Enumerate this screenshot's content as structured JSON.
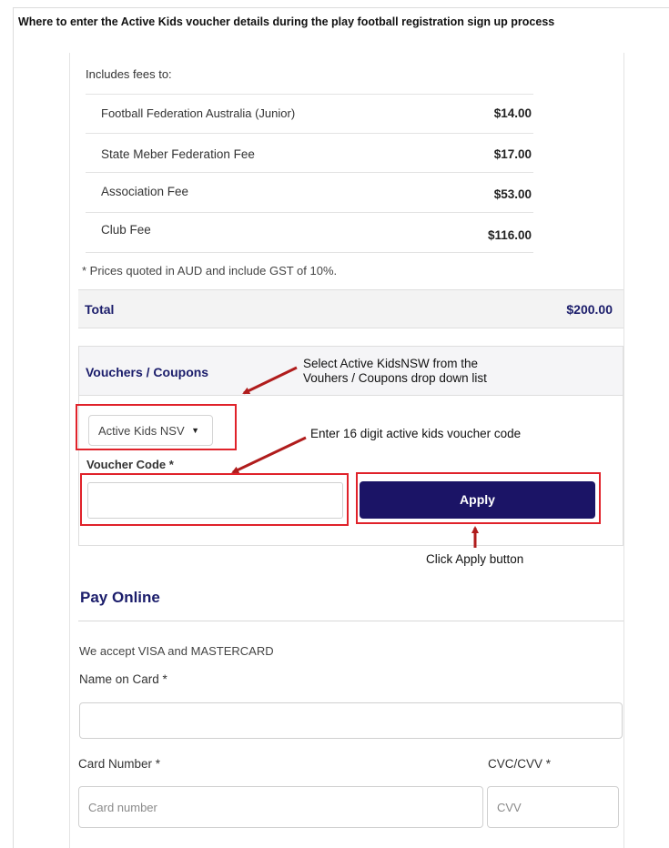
{
  "header": {
    "title": "Where to enter the Active Kids voucher details during the play football registration sign up process"
  },
  "fees": {
    "includes_label": "Includes fees to:",
    "items": [
      {
        "name": "Football Federation Australia (Junior)",
        "amount": "$14.00"
      },
      {
        "name": "State Meber Federation Fee",
        "amount": "$17.00"
      },
      {
        "name": "Association Fee",
        "amount": "$53.00"
      },
      {
        "name": "Club Fee",
        "amount": "$116.00"
      }
    ],
    "note": "* Prices quoted in AUD and include GST of 10%."
  },
  "total": {
    "label": "Total",
    "amount": "$200.00"
  },
  "vouchers": {
    "title": "Vouchers / Coupons",
    "select_value": "Active Kids NSV",
    "code_label": "Voucher Code *",
    "code_value": "",
    "apply_label": "Apply"
  },
  "annotations": {
    "select_line1": "Select Active KidsNSW from the",
    "select_line2": "Vouhers / Coupons drop down list",
    "enter_code": "Enter 16 digit active kids voucher code",
    "click_apply": "Click Apply button",
    "highlight_color": "#e0222a",
    "arrow_color": "#b01c1c"
  },
  "pay": {
    "title": "Pay Online",
    "accept_text": "We accept VISA and MASTERCARD",
    "name_label": "Name on Card *",
    "name_value": "",
    "card_label": "Card Number *",
    "card_placeholder": "Card number",
    "cvc_label": "CVC/CVV *",
    "cvc_placeholder": "CVV"
  },
  "colors": {
    "brand_navy": "#1b1466",
    "heading_navy": "#1b1d6b"
  }
}
